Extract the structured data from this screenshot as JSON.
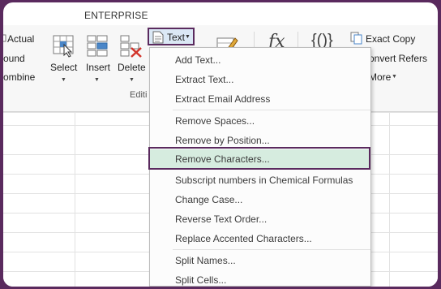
{
  "ribbon": {
    "tab_title": "ENTERPRISE",
    "left_items": [
      "Actual",
      "ound",
      "ombine"
    ],
    "buttons": {
      "select": "Select",
      "insert": "Insert",
      "delete": "Delete"
    },
    "group_label": "Editi",
    "text_button": "Text",
    "fx_glyph": "fx",
    "braces_glyph": "{()}",
    "right_items": {
      "copy": "Exact Copy",
      "convert": "onvert Refers",
      "more": "More"
    }
  },
  "menu": {
    "items": [
      "Add Text...",
      "Extract Text...",
      "Extract Email Address",
      "Remove Spaces...",
      "Remove by Position...",
      "Remove Characters...",
      "Subscript numbers in Chemical Formulas",
      "Change Case...",
      "Reverse Text Order...",
      "Replace Accented Characters...",
      "Split Names...",
      "Split Cells..."
    ],
    "highlighted": "Remove Characters..."
  },
  "colors": {
    "accent_frame": "#5a2a5e",
    "highlight": "#d6ecdf"
  }
}
